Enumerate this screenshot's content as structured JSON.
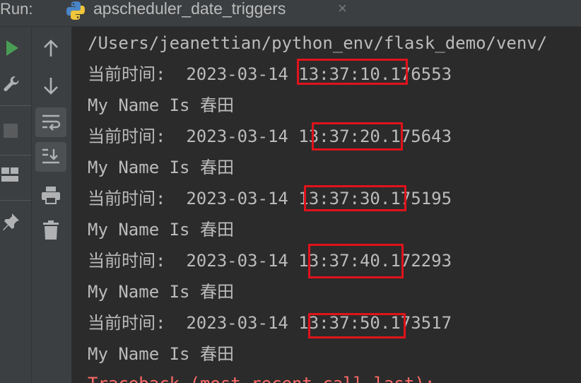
{
  "header": {
    "run_label": "Run:",
    "tab_title": "apscheduler_date_triggers",
    "close_glyph": "×"
  },
  "toolbar_left": {
    "icons": [
      "run-icon",
      "wrench-icon",
      "stop-icon",
      "layout-icon",
      "pin-icon"
    ]
  },
  "toolbar_right": {
    "icons": [
      "arrow-up-icon",
      "arrow-down-icon",
      "soft-wrap-icon",
      "scroll-to-end-icon",
      "print-icon",
      "trash-icon"
    ]
  },
  "console": {
    "lines": [
      "/Users/jeanettian/python_env/flask_demo/venv/",
      "当前时间:  2023-03-14 13:37:10.176553",
      "My Name Is 春田",
      "当前时间:  2023-03-14 13:37:20.175643",
      "My Name Is 春田",
      "当前时间:  2023-03-14 13:37:30.175195",
      "My Name Is 春田",
      "当前时间:  2023-03-14 13:37:40.172293",
      "My Name Is 春田",
      "当前时间:  2023-03-14 13:37:50.173517",
      "My Name Is 春田",
      "Traceback (most recent call last):"
    ]
  },
  "colors": {
    "highlight_border": "#e0131b",
    "run_green": "#499c54",
    "error_red": "#ff6b68"
  }
}
